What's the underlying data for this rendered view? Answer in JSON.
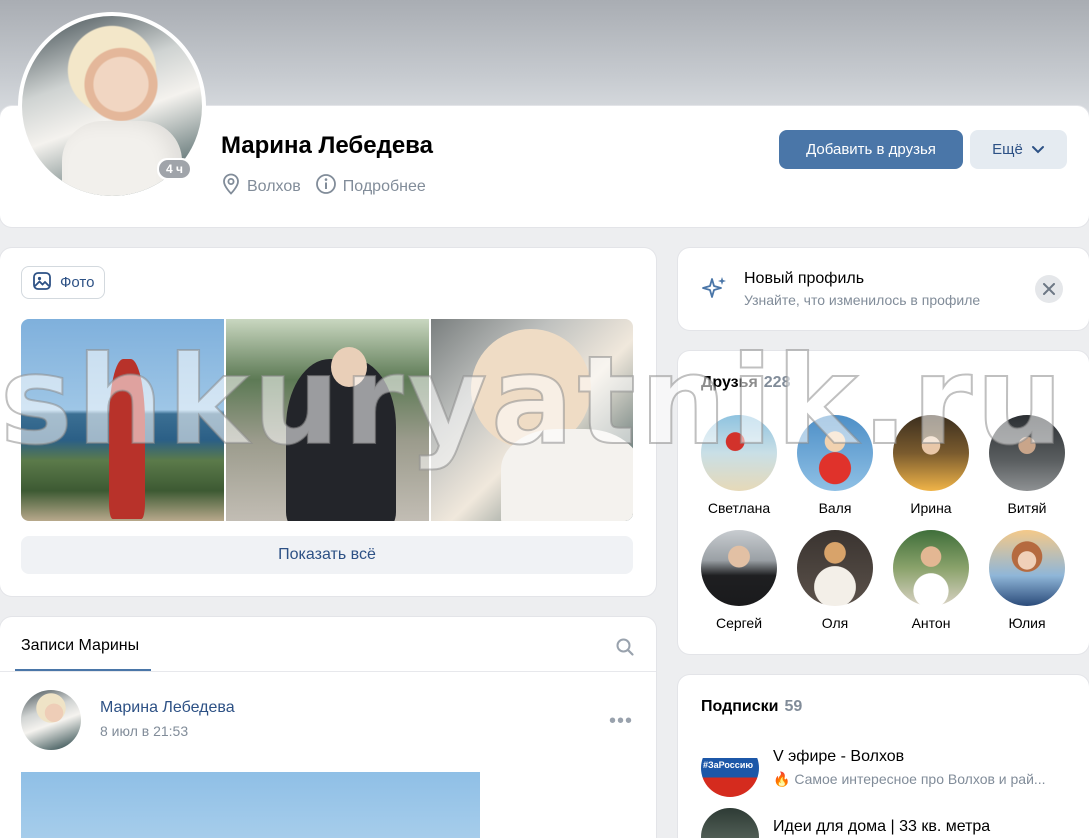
{
  "profile": {
    "name": "Марина Лебедева",
    "online": "4 ч",
    "city": "Волхов",
    "details": "Подробнее",
    "add_friend": "Добавить в друзья",
    "more": "Ещё"
  },
  "photos": {
    "tab_label": "Фото",
    "show_all": "Показать всё"
  },
  "posts": {
    "tab_label": "Записи Марины",
    "author": "Марина Лебедева",
    "date": "8 июл в 21:53"
  },
  "new_profile": {
    "title": "Новый профиль",
    "subtitle": "Узнайте, что изменилось в профиле"
  },
  "friends": {
    "title": "Друзья",
    "count": "228",
    "items": [
      {
        "name": "Светлана"
      },
      {
        "name": "Валя"
      },
      {
        "name": "Ирина"
      },
      {
        "name": "Витяй"
      },
      {
        "name": "Сергей"
      },
      {
        "name": "Оля"
      },
      {
        "name": "Антон"
      },
      {
        "name": "Юлия"
      }
    ]
  },
  "subscriptions": {
    "title": "Подписки",
    "count": "59",
    "items": [
      {
        "name": "V эфире - Волхов",
        "badge": "#ЗаРоссию",
        "desc": "🔥 Самое интересное про Волхов и рай..."
      },
      {
        "name": "Идеи для дома | 33 кв. метра"
      }
    ]
  },
  "watermark": "shkuryatnik.ru",
  "colors": {
    "accent": "#4a76a8",
    "link": "#2d5185",
    "secondary_text": "#818c99",
    "background": "#edeef0"
  }
}
